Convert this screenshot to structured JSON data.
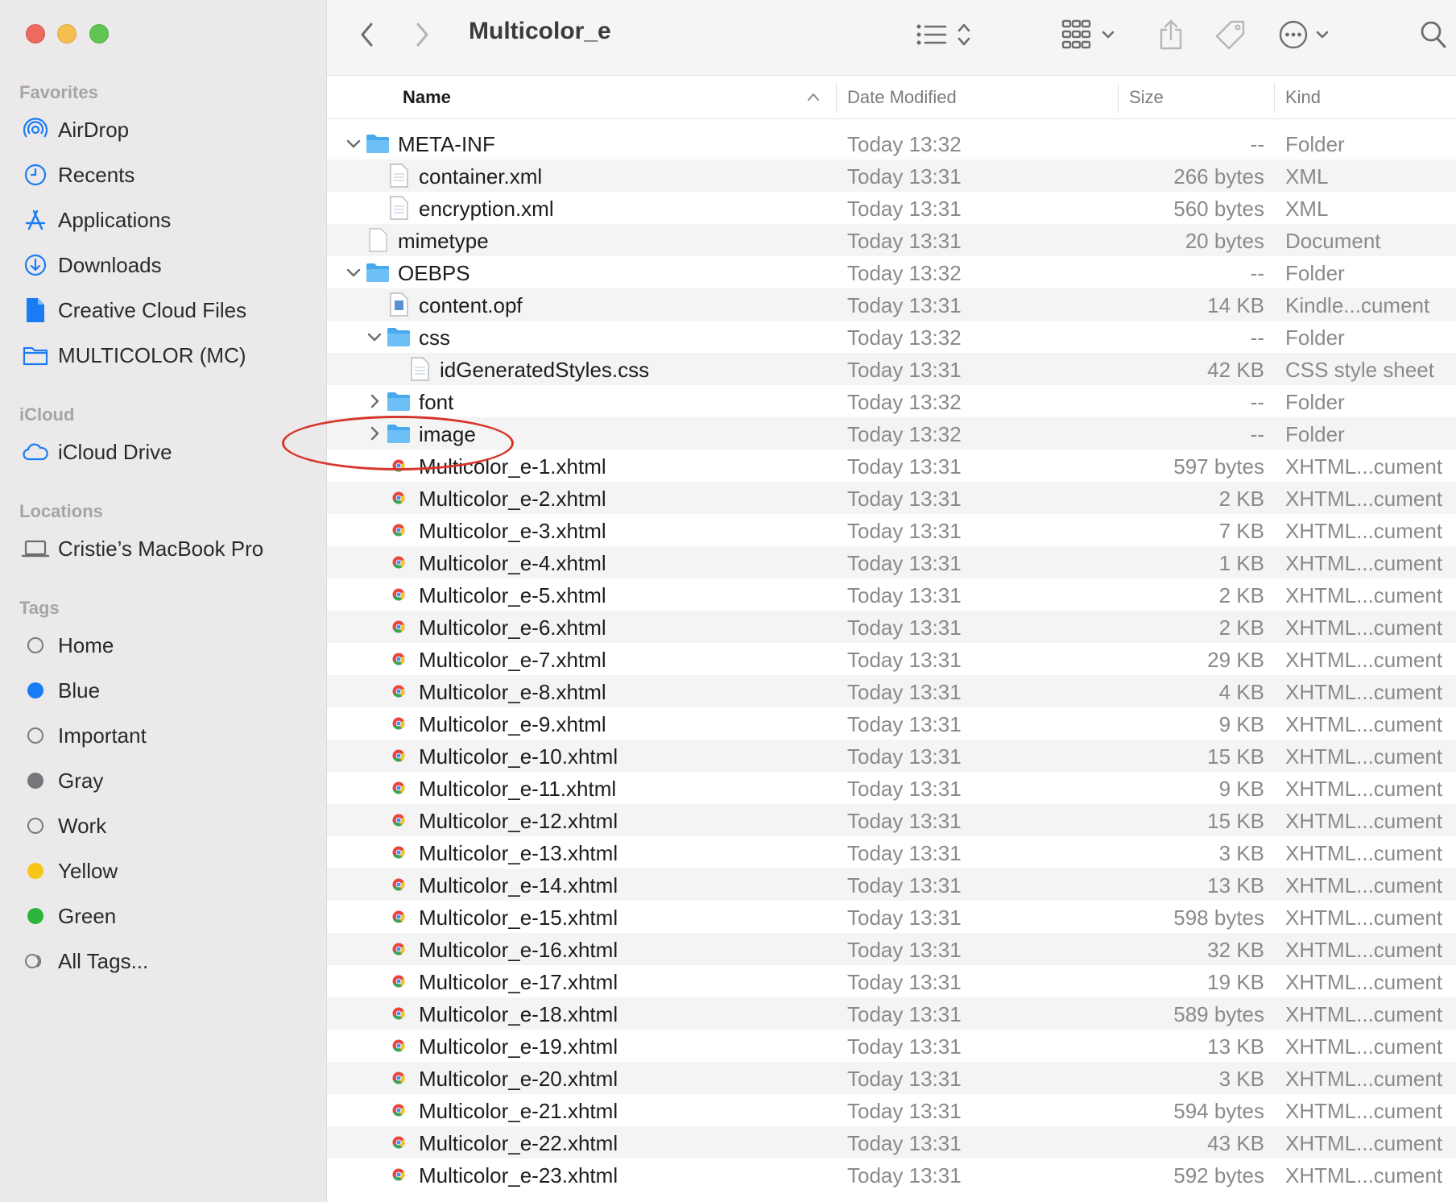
{
  "window": {
    "title": "Multicolor_e"
  },
  "sidebar": {
    "favorites_label": "Favorites",
    "favorites": [
      {
        "label": "AirDrop",
        "icon": "airdrop-icon"
      },
      {
        "label": "Recents",
        "icon": "clock-icon"
      },
      {
        "label": "Applications",
        "icon": "applications-icon"
      },
      {
        "label": "Downloads",
        "icon": "download-icon"
      },
      {
        "label": "Creative Cloud Files",
        "icon": "document-icon"
      },
      {
        "label": "MULTICOLOR (MC)",
        "icon": "folder-icon"
      }
    ],
    "icloud_label": "iCloud",
    "icloud": [
      {
        "label": "iCloud Drive",
        "icon": "cloud-icon"
      }
    ],
    "locations_label": "Locations",
    "locations": [
      {
        "label": "Cristie’s MacBook Pro",
        "icon": "laptop-icon"
      }
    ],
    "tags_label": "Tags",
    "tags": [
      {
        "label": "Home",
        "color": ""
      },
      {
        "label": "Blue",
        "color": "#1a7cf5"
      },
      {
        "label": "Important",
        "color": ""
      },
      {
        "label": "Gray",
        "color": "#77767a"
      },
      {
        "label": "Work",
        "color": ""
      },
      {
        "label": "Yellow",
        "color": "#f5c518"
      },
      {
        "label": "Green",
        "color": "#2bb63b"
      },
      {
        "label": "All Tags...",
        "color": ""
      }
    ]
  },
  "columns": {
    "name": "Name",
    "date": "Date Modified",
    "size": "Size",
    "kind": "Kind"
  },
  "files": [
    {
      "name": "META-INF",
      "date": "Today 13:32",
      "size": "--",
      "kind": "Folder",
      "depth": 0,
      "type": "folder",
      "expanded": true
    },
    {
      "name": "container.xml",
      "date": "Today 13:31",
      "size": "266 bytes",
      "kind": "XML",
      "depth": 1,
      "type": "doc"
    },
    {
      "name": "encryption.xml",
      "date": "Today 13:31",
      "size": "560 bytes",
      "kind": "XML",
      "depth": 1,
      "type": "doc"
    },
    {
      "name": "mimetype",
      "date": "Today 13:31",
      "size": "20 bytes",
      "kind": "Document",
      "depth": 0,
      "type": "blank"
    },
    {
      "name": "OEBPS",
      "date": "Today 13:32",
      "size": "--",
      "kind": "Folder",
      "depth": 0,
      "type": "folder",
      "expanded": true
    },
    {
      "name": "content.opf",
      "date": "Today 13:31",
      "size": "14 KB",
      "kind": "Kindle...cument",
      "depth": 1,
      "type": "kindle"
    },
    {
      "name": "css",
      "date": "Today 13:32",
      "size": "--",
      "kind": "Folder",
      "depth": 1,
      "type": "folder",
      "expanded": true
    },
    {
      "name": "idGeneratedStyles.css",
      "date": "Today 13:31",
      "size": "42 KB",
      "kind": "CSS style sheet",
      "depth": 2,
      "type": "doc"
    },
    {
      "name": "font",
      "date": "Today 13:32",
      "size": "--",
      "kind": "Folder",
      "depth": 1,
      "type": "folder",
      "expanded": false
    },
    {
      "name": "image",
      "date": "Today 13:32",
      "size": "--",
      "kind": "Folder",
      "depth": 1,
      "type": "folder",
      "expanded": false
    },
    {
      "name": "Multicolor_e-1.xhtml",
      "date": "Today 13:31",
      "size": "597 bytes",
      "kind": "XHTML...cument",
      "depth": 1,
      "type": "xhtml"
    },
    {
      "name": "Multicolor_e-2.xhtml",
      "date": "Today 13:31",
      "size": "2 KB",
      "kind": "XHTML...cument",
      "depth": 1,
      "type": "xhtml"
    },
    {
      "name": "Multicolor_e-3.xhtml",
      "date": "Today 13:31",
      "size": "7 KB",
      "kind": "XHTML...cument",
      "depth": 1,
      "type": "xhtml"
    },
    {
      "name": "Multicolor_e-4.xhtml",
      "date": "Today 13:31",
      "size": "1 KB",
      "kind": "XHTML...cument",
      "depth": 1,
      "type": "xhtml"
    },
    {
      "name": "Multicolor_e-5.xhtml",
      "date": "Today 13:31",
      "size": "2 KB",
      "kind": "XHTML...cument",
      "depth": 1,
      "type": "xhtml"
    },
    {
      "name": "Multicolor_e-6.xhtml",
      "date": "Today 13:31",
      "size": "2 KB",
      "kind": "XHTML...cument",
      "depth": 1,
      "type": "xhtml"
    },
    {
      "name": "Multicolor_e-7.xhtml",
      "date": "Today 13:31",
      "size": "29 KB",
      "kind": "XHTML...cument",
      "depth": 1,
      "type": "xhtml"
    },
    {
      "name": "Multicolor_e-8.xhtml",
      "date": "Today 13:31",
      "size": "4 KB",
      "kind": "XHTML...cument",
      "depth": 1,
      "type": "xhtml"
    },
    {
      "name": "Multicolor_e-9.xhtml",
      "date": "Today 13:31",
      "size": "9 KB",
      "kind": "XHTML...cument",
      "depth": 1,
      "type": "xhtml"
    },
    {
      "name": "Multicolor_e-10.xhtml",
      "date": "Today 13:31",
      "size": "15 KB",
      "kind": "XHTML...cument",
      "depth": 1,
      "type": "xhtml"
    },
    {
      "name": "Multicolor_e-11.xhtml",
      "date": "Today 13:31",
      "size": "9 KB",
      "kind": "XHTML...cument",
      "depth": 1,
      "type": "xhtml"
    },
    {
      "name": "Multicolor_e-12.xhtml",
      "date": "Today 13:31",
      "size": "15 KB",
      "kind": "XHTML...cument",
      "depth": 1,
      "type": "xhtml"
    },
    {
      "name": "Multicolor_e-13.xhtml",
      "date": "Today 13:31",
      "size": "3 KB",
      "kind": "XHTML...cument",
      "depth": 1,
      "type": "xhtml"
    },
    {
      "name": "Multicolor_e-14.xhtml",
      "date": "Today 13:31",
      "size": "13 KB",
      "kind": "XHTML...cument",
      "depth": 1,
      "type": "xhtml"
    },
    {
      "name": "Multicolor_e-15.xhtml",
      "date": "Today 13:31",
      "size": "598 bytes",
      "kind": "XHTML...cument",
      "depth": 1,
      "type": "xhtml"
    },
    {
      "name": "Multicolor_e-16.xhtml",
      "date": "Today 13:31",
      "size": "32 KB",
      "kind": "XHTML...cument",
      "depth": 1,
      "type": "xhtml"
    },
    {
      "name": "Multicolor_e-17.xhtml",
      "date": "Today 13:31",
      "size": "19 KB",
      "kind": "XHTML...cument",
      "depth": 1,
      "type": "xhtml"
    },
    {
      "name": "Multicolor_e-18.xhtml",
      "date": "Today 13:31",
      "size": "589 bytes",
      "kind": "XHTML...cument",
      "depth": 1,
      "type": "xhtml"
    },
    {
      "name": "Multicolor_e-19.xhtml",
      "date": "Today 13:31",
      "size": "13 KB",
      "kind": "XHTML...cument",
      "depth": 1,
      "type": "xhtml"
    },
    {
      "name": "Multicolor_e-20.xhtml",
      "date": "Today 13:31",
      "size": "3 KB",
      "kind": "XHTML...cument",
      "depth": 1,
      "type": "xhtml"
    },
    {
      "name": "Multicolor_e-21.xhtml",
      "date": "Today 13:31",
      "size": "594 bytes",
      "kind": "XHTML...cument",
      "depth": 1,
      "type": "xhtml"
    },
    {
      "name": "Multicolor_e-22.xhtml",
      "date": "Today 13:31",
      "size": "43 KB",
      "kind": "XHTML...cument",
      "depth": 1,
      "type": "xhtml"
    },
    {
      "name": "Multicolor_e-23.xhtml",
      "date": "Today 13:31",
      "size": "592 bytes",
      "kind": "XHTML...cument",
      "depth": 1,
      "type": "xhtml"
    }
  ],
  "colors": {
    "accent": "#1a7cf5",
    "folder": "#5fb6f2",
    "annotation": "#d8362b"
  }
}
